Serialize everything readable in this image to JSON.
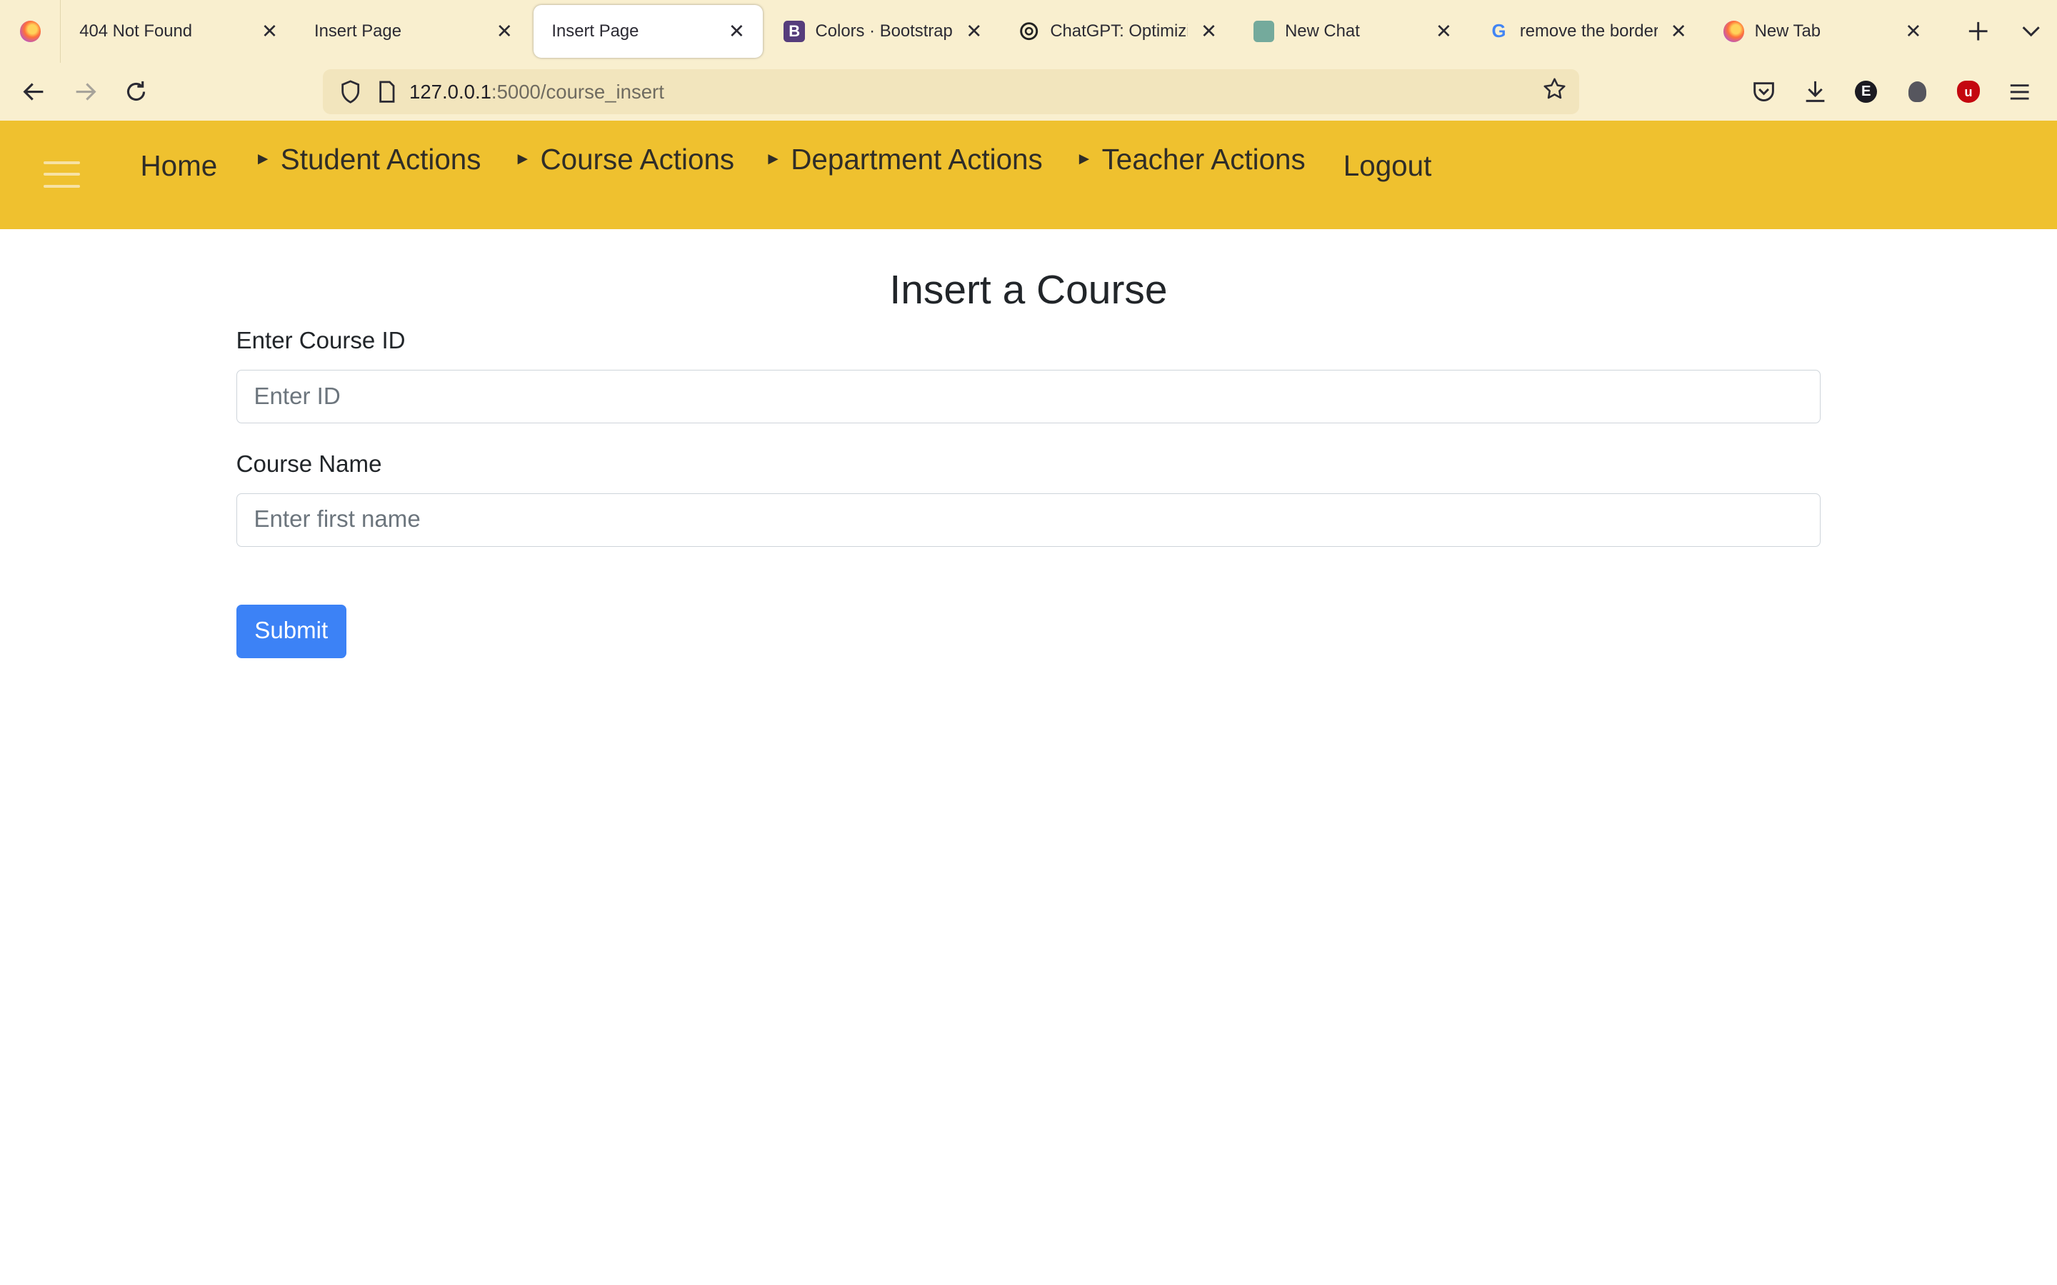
{
  "browser": {
    "tabs": [
      {
        "title": "404 Not Found",
        "icon": "none",
        "active": false
      },
      {
        "title": "Insert Page",
        "icon": "none",
        "active": false
      },
      {
        "title": "Insert Page",
        "icon": "none",
        "active": true
      },
      {
        "title": "Colors · Bootstrap",
        "icon": "bootstrap-icon",
        "icon_text": "B",
        "active": false
      },
      {
        "title": "ChatGPT: Optimizing",
        "icon": "openai-icon",
        "active": false
      },
      {
        "title": "New Chat",
        "icon": "chat-icon",
        "active": false
      },
      {
        "title": "remove the border fr",
        "icon": "google-icon",
        "icon_text": "G",
        "active": false
      },
      {
        "title": "New Tab",
        "icon": "firefox-icon",
        "active": false
      }
    ],
    "url_host": "127.0.0.1",
    "url_path": ":5000/course_insert",
    "extension_e_label": "E"
  },
  "site_nav": {
    "home": "Home",
    "student_actions": "Student Actions",
    "course_actions": "Course Actions",
    "department_actions": "Department Actions",
    "teacher_actions": "Teacher Actions",
    "logout": "Logout",
    "arrow": "►"
  },
  "form": {
    "title": "Insert a Course",
    "course_id_label": "Enter Course ID",
    "course_id_placeholder": "Enter ID",
    "course_name_label": "Course Name",
    "course_name_placeholder": "Enter first name",
    "submit_label": "Submit"
  },
  "colors": {
    "nav_background": "#efc12f",
    "submit_background": "#3c82f6",
    "browser_chrome": "#f9efcf"
  }
}
